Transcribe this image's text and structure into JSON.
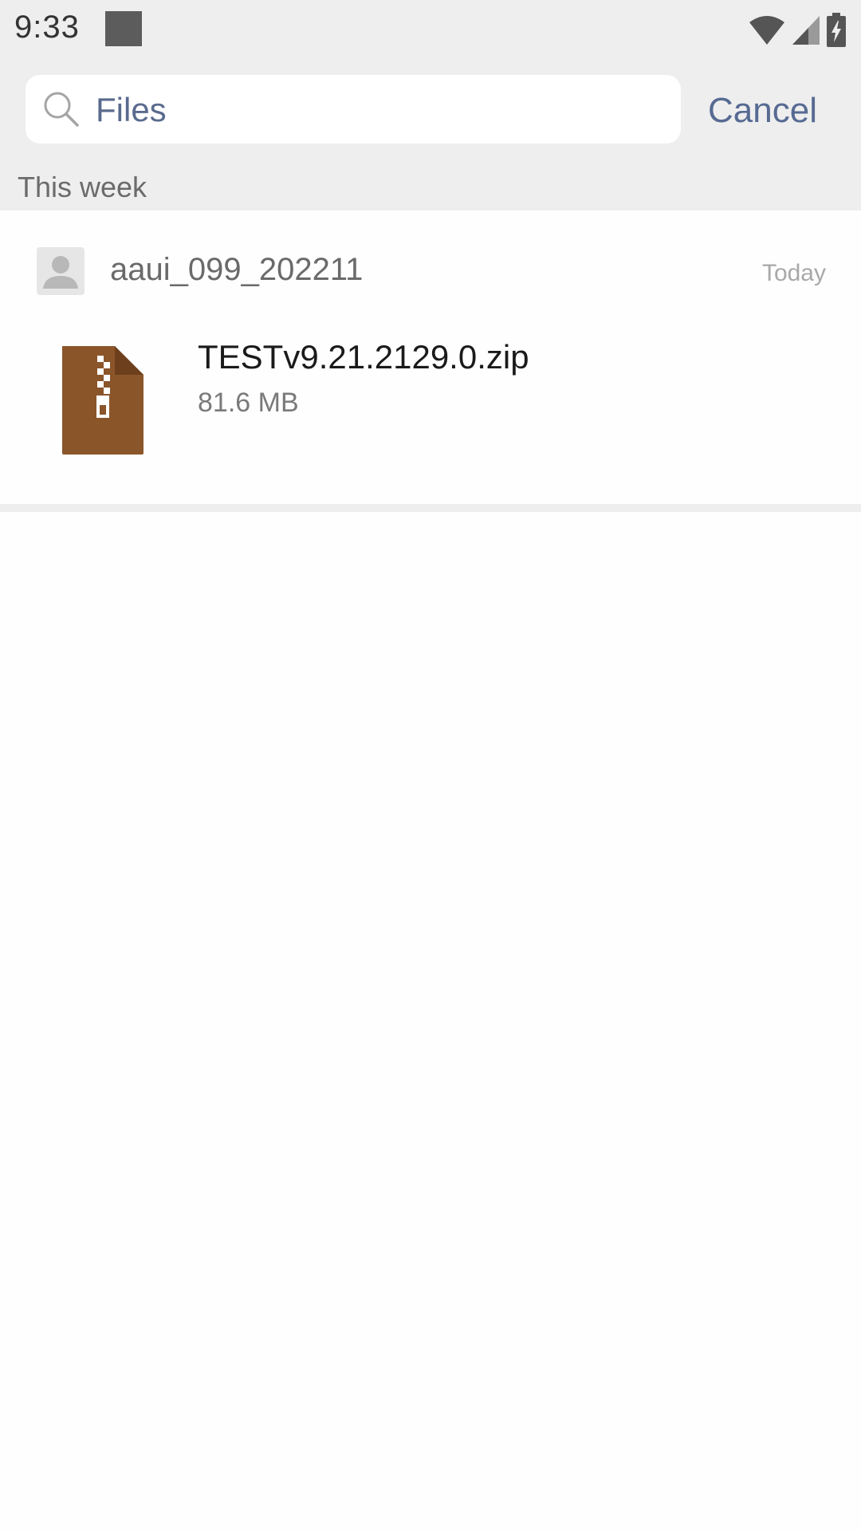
{
  "status_bar": {
    "time": "9:33",
    "icons": [
      "wifi-icon",
      "cellular-signal-icon",
      "battery-charging-icon"
    ]
  },
  "search": {
    "query": "Files",
    "cancel_label": "Cancel"
  },
  "section": {
    "title": "This week"
  },
  "result": {
    "sender": "aaui_099_202211",
    "date": "Today",
    "file": {
      "name": "TESTv9.21.2129.0.zip",
      "size": "81.6 MB",
      "icon": "zip-file-icon",
      "icon_color": "#8b552a"
    }
  },
  "colors": {
    "accent": "#566a92",
    "background": "#eeeeee"
  }
}
